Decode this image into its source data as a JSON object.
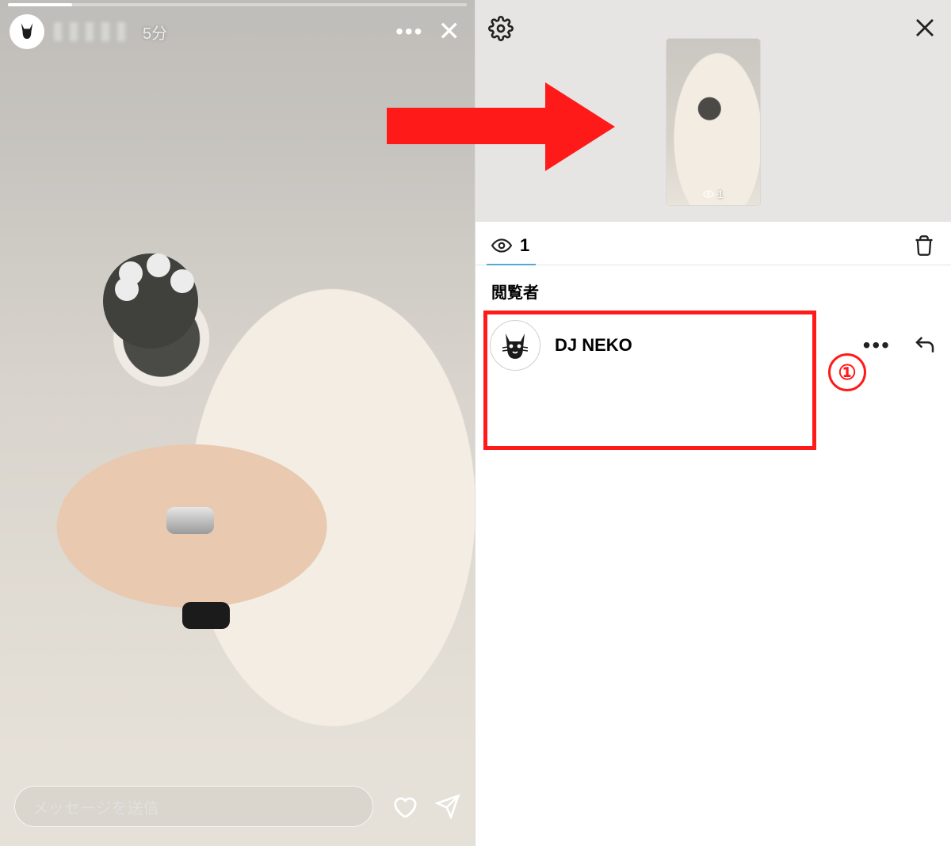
{
  "left": {
    "time": "5分",
    "message_placeholder": "メッセージを送信"
  },
  "right": {
    "thumb_view_count": "1",
    "view_count": "1",
    "viewers_title": "閲覧者",
    "viewers": [
      {
        "name": "DJ NEKO"
      }
    ]
  },
  "annotation": {
    "badge": "①"
  }
}
